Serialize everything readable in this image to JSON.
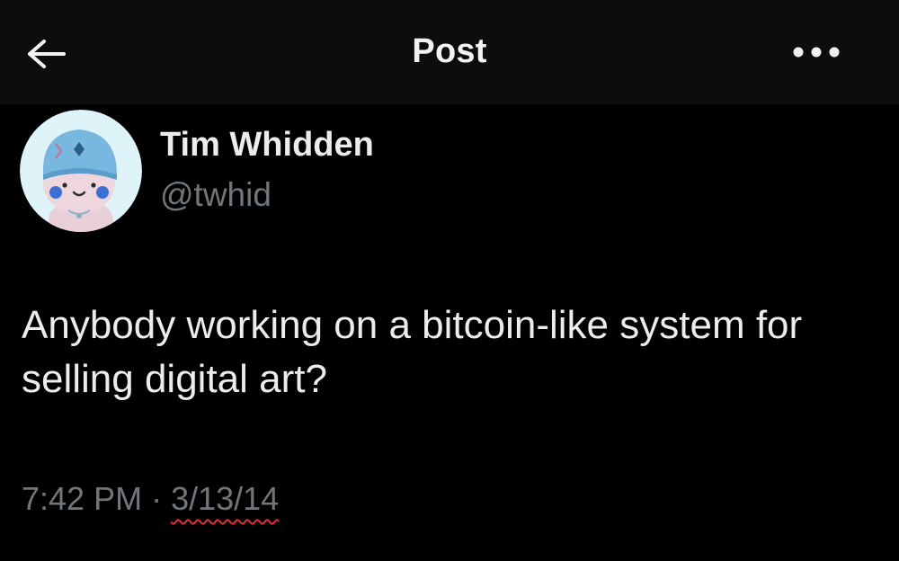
{
  "header": {
    "title": "Post",
    "back_icon": "arrow-left-icon",
    "more_icon": "more-horizontal-icon"
  },
  "author": {
    "name": "Tim Whidden",
    "handle": "@twhid",
    "avatar_icon": "cartoon-character-avatar"
  },
  "post": {
    "text": "Anybody working on a bitcoin-like system for selling digital art?",
    "time": "7:42 PM",
    "separator": "·",
    "date": "3/13/14"
  },
  "colors": {
    "background": "#000000",
    "header_background": "#0d0d0d",
    "text_primary": "#e7e9ea",
    "text_secondary": "#71767b",
    "spellcheck_underline": "#e0303a"
  }
}
